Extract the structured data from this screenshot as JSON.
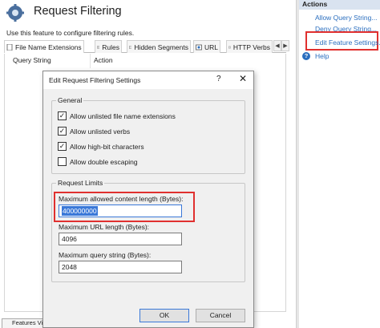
{
  "header": {
    "title": "Request Filtering",
    "description": "Use this feature to configure filtering rules."
  },
  "tabs": [
    {
      "label": "File Name Extensions",
      "icon": "file-icon"
    },
    {
      "label": "Rules",
      "icon": "rules-icon"
    },
    {
      "label": "Hidden Segments",
      "icon": "hidden-segments-icon"
    },
    {
      "label": "URL",
      "icon": "url-icon"
    },
    {
      "label": "HTTP Verbs",
      "icon": "http-verbs-icon"
    }
  ],
  "grid": {
    "columns": [
      "Query String",
      "Action"
    ]
  },
  "bottom_tab": {
    "label": "Features View"
  },
  "actions": {
    "heading": "Actions",
    "links": [
      "Allow Query String...",
      "Deny Query String...",
      "Edit Feature Settings..."
    ],
    "help": "Help"
  },
  "dialog": {
    "title": "Edit Request Filtering Settings",
    "help_glyph": "?",
    "close_glyph": "✕",
    "general": {
      "heading": "General",
      "options": [
        {
          "label": "Allow unlisted file name extensions",
          "checked": true
        },
        {
          "label": "Allow unlisted verbs",
          "checked": true
        },
        {
          "label": "Allow high-bit characters",
          "checked": true
        },
        {
          "label": "Allow double escaping",
          "checked": false
        }
      ]
    },
    "limits": {
      "heading": "Request Limits",
      "content_length_label": "Maximum allowed content length (Bytes):",
      "content_length_value": "400000000",
      "url_length_label": "Maximum URL length (Bytes):",
      "url_length_value": "4096",
      "query_string_label": "Maximum query string (Bytes):",
      "query_string_value": "2048"
    },
    "ok_label": "OK",
    "cancel_label": "Cancel"
  },
  "colors": {
    "link": "#2a6ebf",
    "highlight": "#e0302f",
    "selection": "#3a78d8",
    "actions_header": "#d9e3f0"
  }
}
